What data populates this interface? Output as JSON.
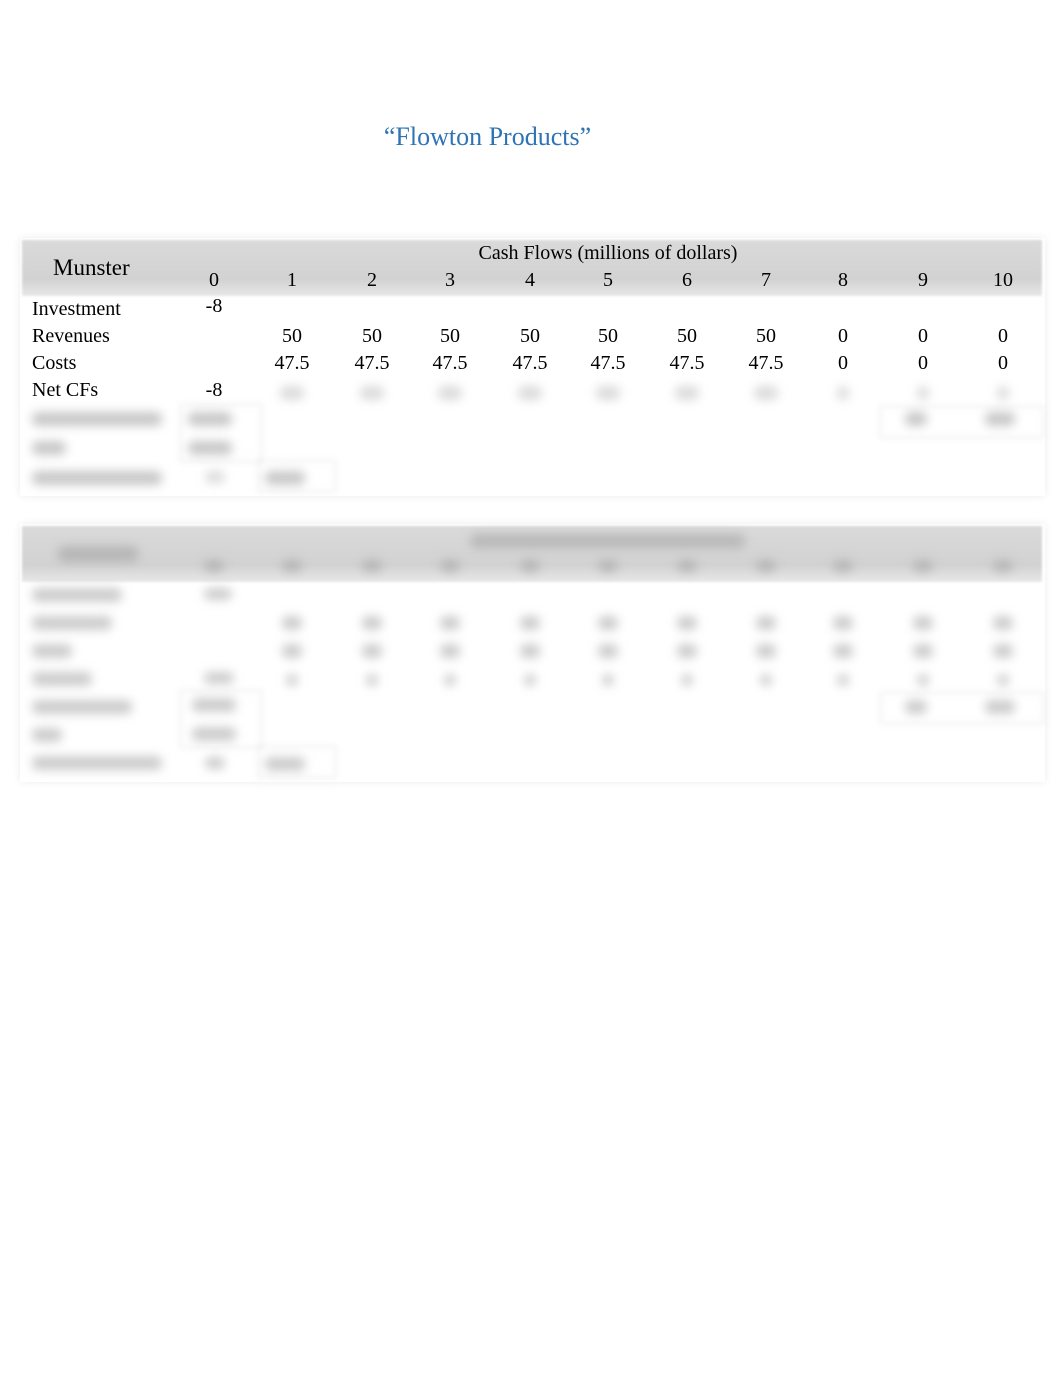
{
  "document": {
    "title": "“Flowton Products”"
  },
  "tables": [
    {
      "project_name": "Munster",
      "caption": "Cash Flows (millions of dollars)",
      "years": [
        "0",
        "1",
        "2",
        "3",
        "4",
        "5",
        "6",
        "7",
        "8",
        "9",
        "10"
      ],
      "rows": [
        {
          "label": "Investment",
          "values": [
            "-8",
            "",
            "",
            "",
            "",
            "",
            "",
            "",
            "",
            "",
            ""
          ]
        },
        {
          "label": "Revenues",
          "values": [
            "",
            "50",
            "50",
            "50",
            "50",
            "50",
            "50",
            "50",
            "0",
            "0",
            "0"
          ]
        },
        {
          "label": "Costs",
          "values": [
            "",
            "47.5",
            "47.5",
            "47.5",
            "47.5",
            "47.5",
            "47.5",
            "47.5",
            "0",
            "0",
            "0"
          ]
        },
        {
          "label": "Net CFs",
          "values": [
            "-8",
            "",
            "",
            "",
            "",
            "",
            "",
            "",
            "",
            "",
            ""
          ]
        }
      ],
      "obscured": "Net CFs years 1-10, NPV, IRR and Payback period rows are blurred"
    },
    {
      "obscured": "Entire second project table is blurred and unreadable"
    }
  ]
}
